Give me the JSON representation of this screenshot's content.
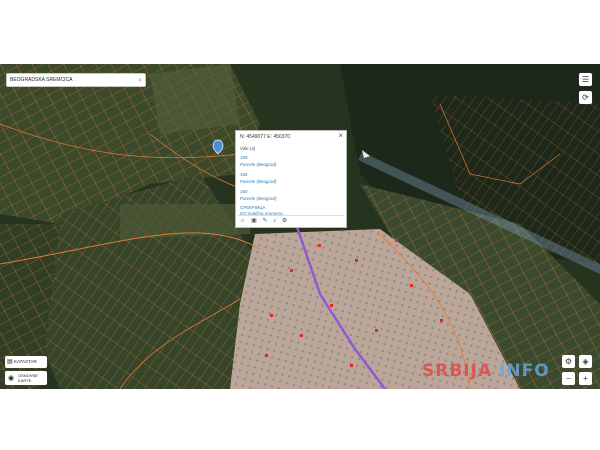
{
  "search": {
    "value": "BEOGRADSKA SREMČICA",
    "icon": "search-icon"
  },
  "right_controls": {
    "layers_icon": "layers-icon",
    "refresh_icon": "refresh-icon"
  },
  "popup": {
    "header": "N: 4549077 E: 450370",
    "line_intro": "Više (4)",
    "items": [
      {
        "number": "159",
        "subtitle": "Parcele (Beograd)"
      },
      {
        "number": "158",
        "subtitle": "Parcele (Beograd)"
      },
      {
        "number": "160",
        "subtitle": "Parcele (Beograd)"
      }
    ],
    "municipality": "СРЕМЧИЦА",
    "municipality_sub": "KO matična promena",
    "close_icon": "close-icon",
    "tools": [
      "settings-icon",
      "export-icon",
      "edit-icon",
      "microphone-icon",
      "more-icon"
    ]
  },
  "bottom_left": {
    "katastar_label": "KATASTAR",
    "osnovne_line1": "OSNOVNE",
    "osnovne_line2": "KARTE"
  },
  "bottom_right": {
    "gear_icon": "gear-icon",
    "compass_icon": "compass-icon"
  },
  "watermark": {
    "part1": "SRBIJA",
    "part2": "INFO"
  },
  "colors": {
    "parcel": "#e8773a",
    "road": "#8c5bd6",
    "marker": "#e02828",
    "pin": "#4a90d9"
  }
}
